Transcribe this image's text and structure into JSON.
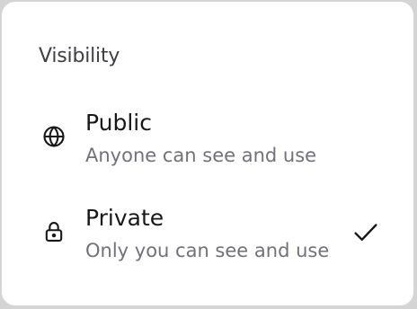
{
  "visibility": {
    "title": "Visibility",
    "options": [
      {
        "label": "Public",
        "description": "Anyone can see and use",
        "icon": "globe-icon",
        "selected": false
      },
      {
        "label": "Private",
        "description": "Only you can see and use",
        "icon": "lock-icon",
        "selected": true
      }
    ],
    "selected_icon": "checkmark-icon"
  },
  "colors": {
    "background": "#ffffff",
    "border": "#d6d6d6",
    "title": "#3f3f46",
    "label": "#18181b",
    "description": "#71717a"
  }
}
